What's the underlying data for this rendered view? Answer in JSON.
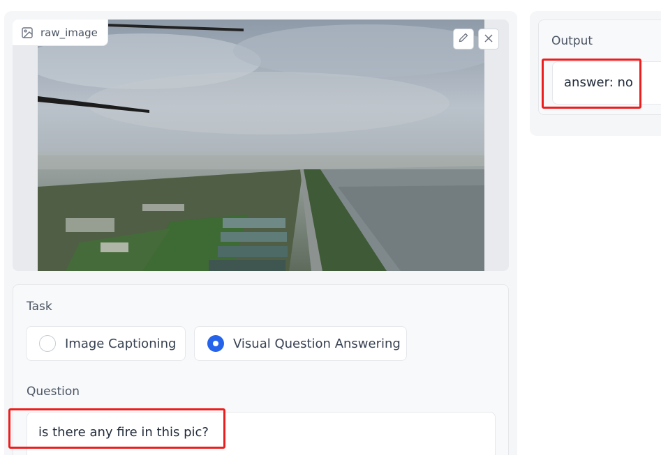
{
  "image_input": {
    "label": "raw_image",
    "label_icon": "image-icon",
    "edit_icon": "pencil-icon",
    "close_icon": "close-icon"
  },
  "task": {
    "label": "Task",
    "options": [
      {
        "label": "Image Captioning",
        "selected": false
      },
      {
        "label": "Visual Question Answering",
        "selected": true
      }
    ]
  },
  "question": {
    "label": "Question",
    "value": "is there any fire in this pic?"
  },
  "output": {
    "label": "Output",
    "value": "answer: no"
  },
  "colors": {
    "accent": "#2563eb",
    "highlight": "#ee1d1d",
    "panel_bg": "#f5f6f8"
  }
}
